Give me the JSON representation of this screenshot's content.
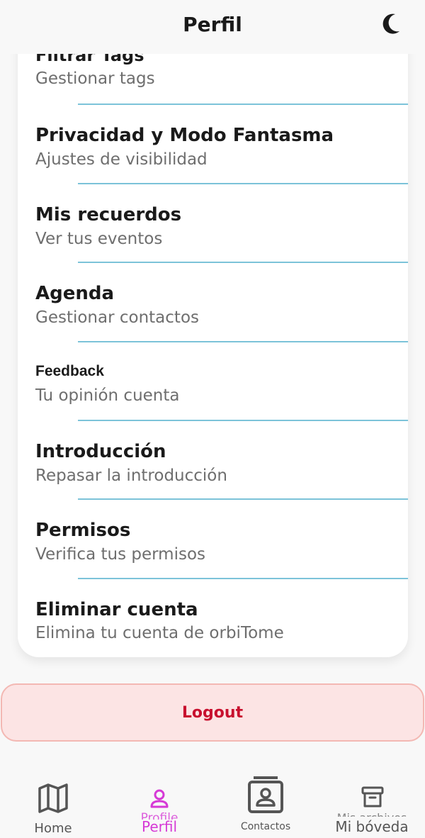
{
  "header": {
    "title": "Perfil"
  },
  "menu": [
    {
      "title": "Filtrar Tags",
      "subtitle": "Gestionar tags"
    },
    {
      "title": "Privacidad y Modo Fantasma",
      "subtitle": "Ajustes de visibilidad"
    },
    {
      "title": "Mis recuerdos",
      "subtitle": "Ver tus eventos"
    },
    {
      "title": "Agenda",
      "subtitle": "Gestionar contactos"
    },
    {
      "title": "Feedback",
      "subtitle": "Tu opinión cuenta"
    },
    {
      "title": "Introducción",
      "subtitle": "Repasar la introducción"
    },
    {
      "title": "Permisos",
      "subtitle": "Verifica tus permisos"
    },
    {
      "title": "Eliminar cuenta",
      "subtitle": "Elimina tu cuenta de orbiTome"
    }
  ],
  "logout": {
    "label": "Logout"
  },
  "nav": {
    "home": "Home",
    "profile_ghost": "Profile",
    "profile": "Perfil",
    "contacts": "Contactos",
    "vault": "Mi bóveda",
    "vault_ghost": "Mis archivos"
  },
  "colors": {
    "accent": "#d63ad6",
    "divider": "#7cc3d9",
    "logout_text": "#c8102e",
    "logout_bg": "#fce4e4"
  },
  "icons": {
    "theme": "moon-icon",
    "home": "map-icon",
    "profile": "person-icon",
    "contacts": "contact-card-icon",
    "vault": "archive-box-icon"
  }
}
